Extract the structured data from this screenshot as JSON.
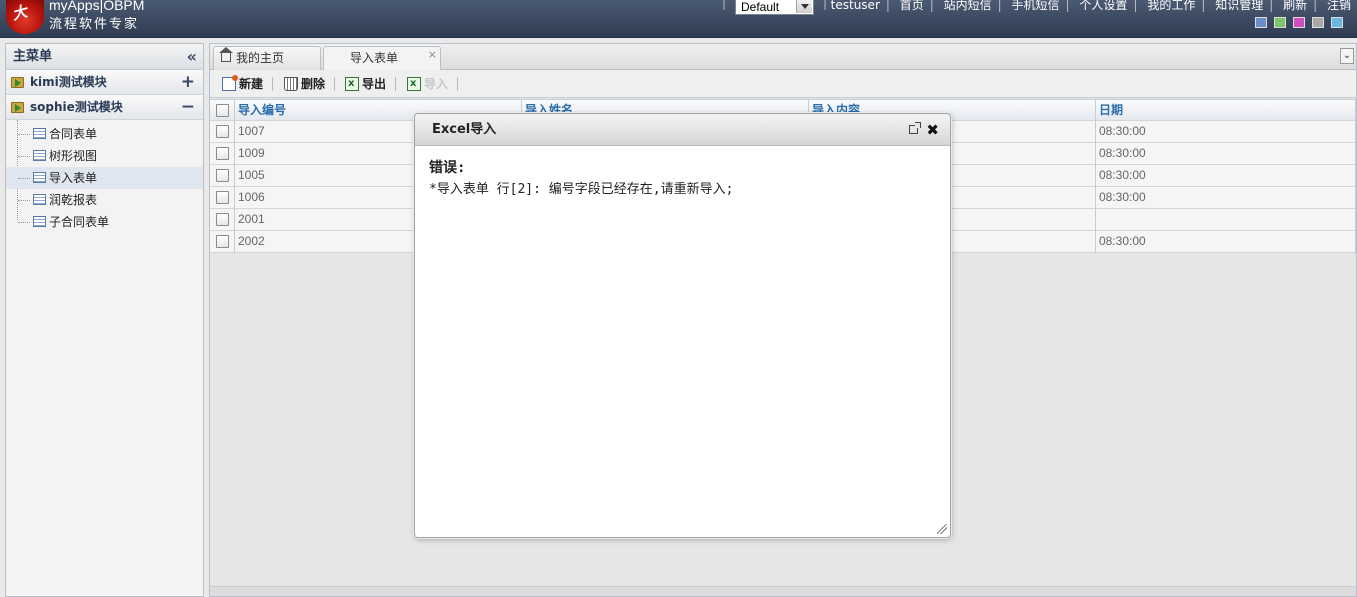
{
  "header": {
    "logo_char": "大",
    "brand_title": "myApps|OBPM",
    "brand_subtitle": "流程软件专家",
    "skin_select": "Default",
    "nav": [
      "testuser",
      "首页",
      "站内短信",
      "手机短信",
      "个人设置",
      "我的工作",
      "知识管理",
      "刷新",
      "注销"
    ],
    "skins": [
      "#6a8fc8",
      "#7cc36a",
      "#d04fc0",
      "#a8a8a8",
      "#6ab8e0"
    ]
  },
  "sidebar": {
    "title": "主菜单",
    "collapse_glyph": "«",
    "modules": [
      {
        "label": "kimi测试模块",
        "toggle": "+"
      },
      {
        "label": "sophie测试模块",
        "toggle": "−"
      }
    ],
    "items": [
      {
        "label": "合同表单"
      },
      {
        "label": "树形视图"
      },
      {
        "label": "导入表单"
      },
      {
        "label": "润乾报表"
      },
      {
        "label": "子合同表单"
      }
    ]
  },
  "tabs": {
    "home_label": "我的主页",
    "active_label": "导入表单",
    "close_glyph": "×",
    "collapse_glyph": "⌄"
  },
  "toolbar": {
    "new_label": "新建",
    "delete_label": "删除",
    "export_label": "导出",
    "import_label": "导入"
  },
  "grid": {
    "columns": [
      "导入编号",
      "导入姓名",
      "导入内容",
      "日期"
    ],
    "rows": [
      {
        "id": "1007",
        "date": "08:30:00"
      },
      {
        "id": "1009",
        "date": "08:30:00"
      },
      {
        "id": "1005",
        "date": "08:30:00"
      },
      {
        "id": "1006",
        "date": "08:30:00"
      },
      {
        "id": "2001",
        "date": ""
      },
      {
        "id": "2002",
        "date": "08:30:00"
      }
    ]
  },
  "dialog": {
    "title": "Excel导入",
    "close_glyph": "✖",
    "error_title": "错误:",
    "error_message": "*导入表单 行[2]: 编号字段已经存在,请重新导入;"
  }
}
